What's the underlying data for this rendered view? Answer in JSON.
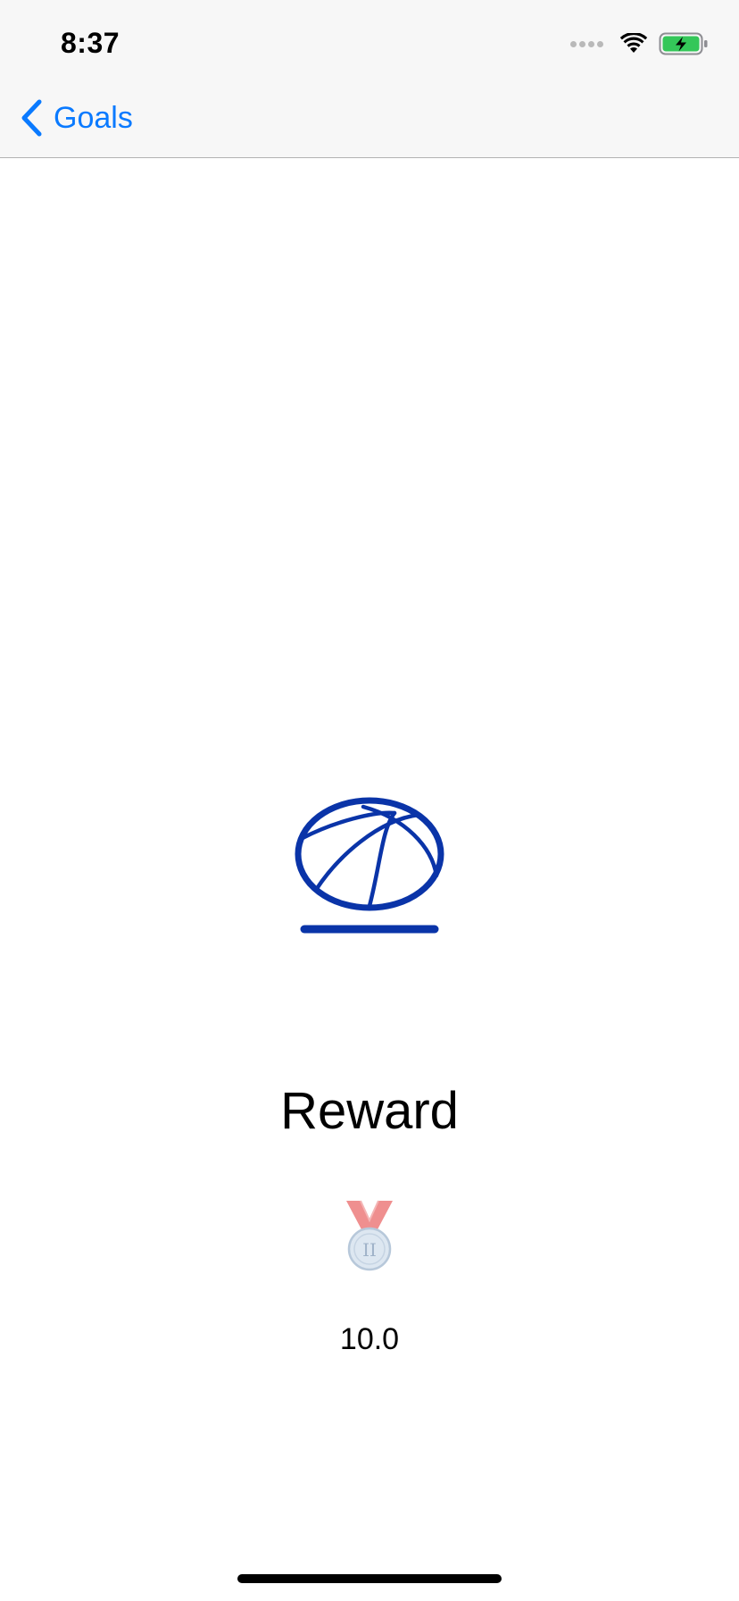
{
  "status_bar": {
    "time": "8:37"
  },
  "nav": {
    "back_label": "Goals",
    "accent_color": "#0a7aff"
  },
  "content": {
    "goal_icon": "basketball-icon",
    "reward_title": "Reward",
    "medal_icon": "second-place-medal-icon",
    "reward_value": "10.0"
  },
  "colors": {
    "icon_blue": "#0a34a8",
    "battery_green": "#34c759"
  }
}
